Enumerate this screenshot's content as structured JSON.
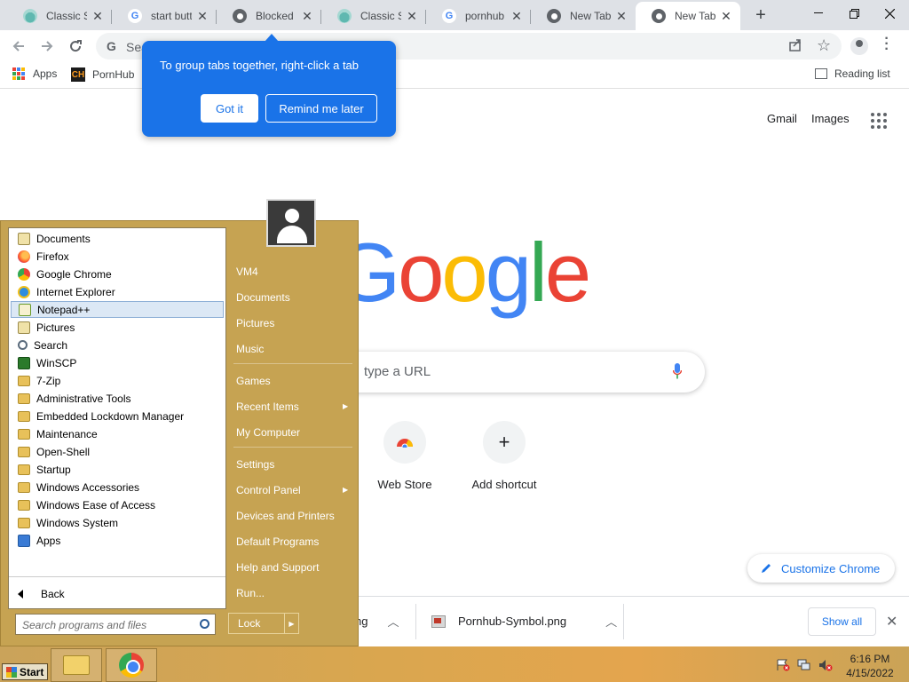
{
  "tabs": [
    {
      "title": "Classic Sh",
      "favicon": "classic-shell-icon",
      "x": 0
    },
    {
      "title": "start butto",
      "favicon": "google-icon",
      "x": 0
    },
    {
      "title": "Blocked b",
      "favicon": "chrome-globe-icon",
      "x": 0
    },
    {
      "title": "Classic Sh",
      "favicon": "classic-shell-icon",
      "x": 0
    },
    {
      "title": "pornhub l",
      "favicon": "google-icon",
      "x": 0
    },
    {
      "title": "New Tab",
      "favicon": "chrome-icon",
      "x": 0
    },
    {
      "title": "New Tab",
      "favicon": "chrome-icon",
      "active": true
    }
  ],
  "omnibox": {
    "text": "Sea"
  },
  "bookmarks": {
    "apps": "Apps",
    "pornhub": "PornHub",
    "reading_list": "Reading list",
    "ph_logo_text": "CH"
  },
  "callout": {
    "text": "To group tabs together, right-click a tab",
    "got_it": "Got it",
    "remind_later": "Remind me later"
  },
  "ntp": {
    "gmail": "Gmail",
    "images": "Images",
    "logo_letters": [
      {
        "ch": "G",
        "color": "#4285f4"
      },
      {
        "ch": "o",
        "color": "#ea4335"
      },
      {
        "ch": "o",
        "color": "#fbbc05"
      },
      {
        "ch": "g",
        "color": "#4285f4"
      },
      {
        "ch": "l",
        "color": "#34a853"
      },
      {
        "ch": "e",
        "color": "#ea4335"
      }
    ],
    "search_placeholder": "type a URL",
    "shortcuts": [
      {
        "label": "Web Store"
      },
      {
        "label": "Add shortcut"
      }
    ],
    "customize": "Customize Chrome"
  },
  "downloads": {
    "items": [
      {
        "name": "ng"
      },
      {
        "name": "Pornhub-Symbol.png"
      }
    ],
    "show_all": "Show all"
  },
  "start_menu": {
    "programs": [
      {
        "label": "Documents",
        "icon": "doc"
      },
      {
        "label": "Firefox",
        "icon": "firefox"
      },
      {
        "label": "Google Chrome",
        "icon": "chrome"
      },
      {
        "label": "Internet Explorer",
        "icon": "ie"
      },
      {
        "label": "Notepad++",
        "icon": "notepad",
        "highlighted": true
      },
      {
        "label": "Pictures",
        "icon": "doc"
      },
      {
        "label": "Search",
        "icon": "search"
      },
      {
        "label": "WinSCP",
        "icon": "winscp"
      },
      {
        "label": "7-Zip",
        "icon": "folder"
      },
      {
        "label": "Administrative Tools",
        "icon": "folder"
      },
      {
        "label": "Embedded Lockdown Manager",
        "icon": "folder"
      },
      {
        "label": "Maintenance",
        "icon": "folder"
      },
      {
        "label": "Open-Shell",
        "icon": "folder"
      },
      {
        "label": "Startup",
        "icon": "folder"
      },
      {
        "label": "Windows Accessories",
        "icon": "folder"
      },
      {
        "label": "Windows Ease of Access",
        "icon": "folder"
      },
      {
        "label": "Windows System",
        "icon": "folder"
      },
      {
        "label": "Apps",
        "icon": "apps"
      }
    ],
    "back": "Back",
    "search_placeholder": "Search programs and files",
    "right_items": [
      {
        "label": "VM4"
      },
      {
        "label": "Documents"
      },
      {
        "label": "Pictures"
      },
      {
        "label": "Music"
      },
      {
        "label": "Games"
      },
      {
        "label": "Recent Items",
        "submenu": true
      },
      {
        "label": "My Computer"
      },
      {
        "label": "Settings"
      },
      {
        "label": "Control Panel",
        "submenu": true
      },
      {
        "label": "Devices and Printers"
      },
      {
        "label": "Default Programs"
      },
      {
        "label": "Help and Support"
      },
      {
        "label": "Run..."
      }
    ],
    "lock": "Lock"
  },
  "taskbar": {
    "start": "Start",
    "time": "6:16 PM",
    "date": "4/15/2022"
  }
}
